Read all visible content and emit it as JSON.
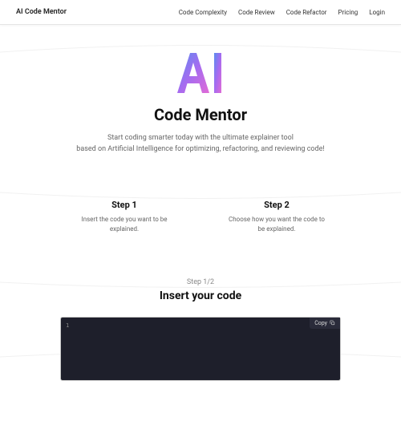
{
  "header": {
    "brand": "AI Code Mentor",
    "nav": {
      "complexity": "Code Complexity",
      "review": "Code Review",
      "refactor": "Code Refactor",
      "pricing": "Pricing",
      "login": "Login"
    }
  },
  "hero": {
    "title": "Code Mentor",
    "subtitle_line1": "Start coding smarter today with the ultimate explainer tool",
    "subtitle_line2": "based on Artificial Intelligence for optimizing, refactoring, and reviewing code!"
  },
  "steps": {
    "s1": {
      "title": "Step 1",
      "desc": "Insert the code you want to be explained."
    },
    "s2": {
      "title": "Step 2",
      "desc": "Choose how you want the code to be explained."
    }
  },
  "insert": {
    "indicator": "Step 1/2",
    "title": "Insert your code",
    "copy_label": "Copy",
    "line_number": "1"
  }
}
